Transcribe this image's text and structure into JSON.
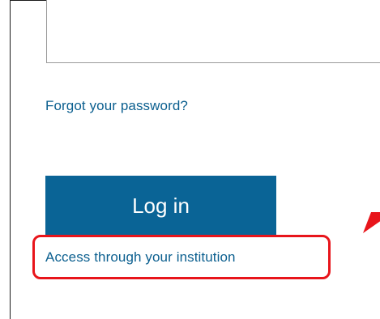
{
  "form": {
    "password_value": "",
    "forgot_password_label": "Forgot your password?",
    "login_button_label": "Log in",
    "institution_access_label": "Access through your institution"
  },
  "annotation": {
    "highlight_color": "#e8151b",
    "arrow_color": "#e8151b"
  },
  "colors": {
    "link": "#0b5f8f",
    "button_bg": "#0a6496",
    "button_text": "#ffffff"
  }
}
